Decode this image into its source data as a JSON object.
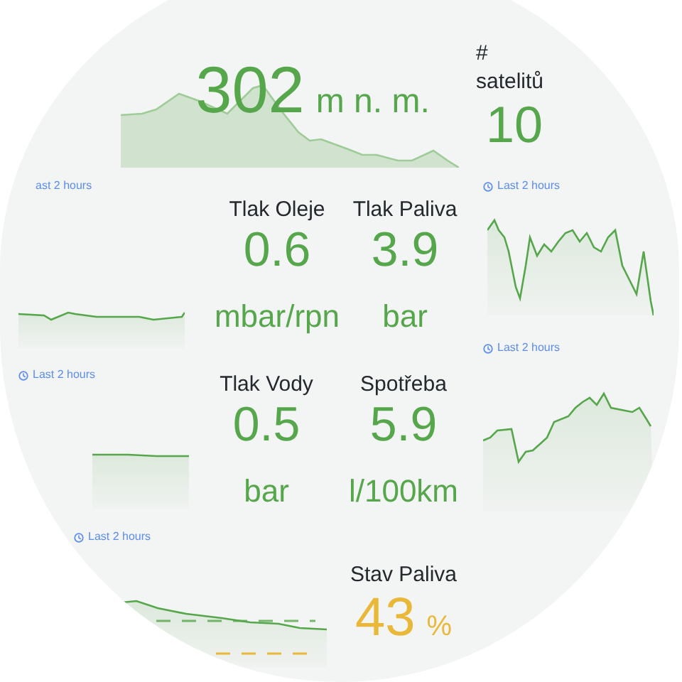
{
  "stats": [
    {
      "value": "302",
      "unit": "m n. m.",
      "color": "#56a64b"
    },
    {
      "title": "# satelitů",
      "value": "10",
      "color": "#56a64b"
    },
    {
      "title": "Tlak Oleje",
      "value": "0.6",
      "unit": "mbar/rpn",
      "color": "#56a64b"
    },
    {
      "title": "Tlak Paliva",
      "value": "3.9",
      "unit": "bar",
      "color": "#56a64b"
    },
    {
      "title": "Tlak Vody",
      "value": "0.5",
      "unit": "bar",
      "color": "#56a64b"
    },
    {
      "title": "Spotřeba",
      "value": "5.9",
      "unit": "l/100km",
      "color": "#56a64b"
    },
    {
      "title": "Stav Paliva",
      "value": "43",
      "unit": "%",
      "color": "#eab839"
    }
  ],
  "time_labels": [
    "ast 2 hours",
    "Last 2 hours",
    "Last 2 hours",
    "Last 2 hours",
    "Last 2 hours"
  ]
}
